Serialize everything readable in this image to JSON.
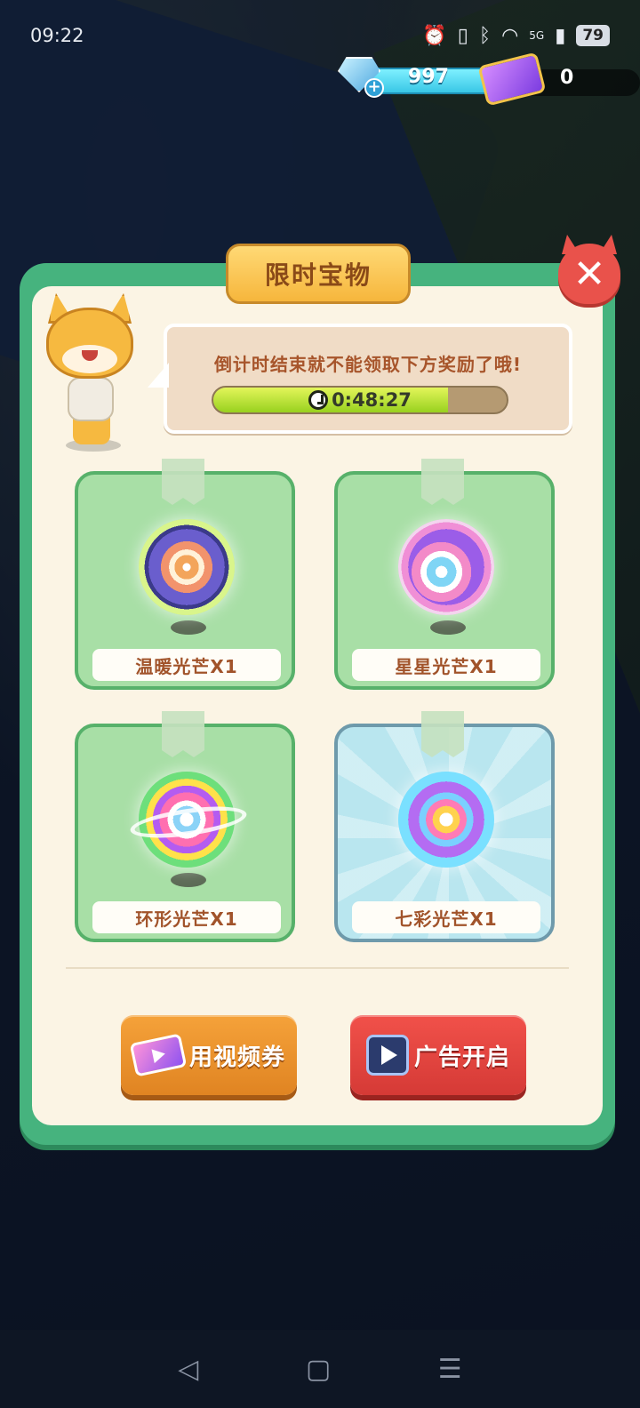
{
  "status_bar": {
    "time": "09:22",
    "network": "5G",
    "battery": "79"
  },
  "currency": {
    "gems": "997",
    "tickets": "0"
  },
  "dialog": {
    "title": "限时宝物",
    "message": "倒计时结束就不能领取下方奖励了哦!",
    "timer": "0:48:27",
    "timer_progress_fraction": 0.8,
    "rewards": [
      {
        "label": "温暖光芒X1",
        "icon": "warm-light-orb"
      },
      {
        "label": "星星光芒X1",
        "icon": "star-light-orb"
      },
      {
        "label": "环形光芒X1",
        "icon": "ring-light-orb"
      },
      {
        "label": "七彩光芒X1",
        "icon": "rainbow-light-orb"
      }
    ],
    "buttons": {
      "use_ticket": "用视频券",
      "watch_ad": "广告开启"
    }
  },
  "colors": {
    "dialog_border": "#46b37e",
    "dialog_inner": "#fbf4e4",
    "title_tab": "#f6b63c",
    "close_button": "#e9524b",
    "orange_button": "#e08422",
    "red_button": "#d53a36",
    "timer_fill": "#98d11f"
  },
  "nav": {
    "back": "◁",
    "home": "▢",
    "menu": "☰"
  }
}
